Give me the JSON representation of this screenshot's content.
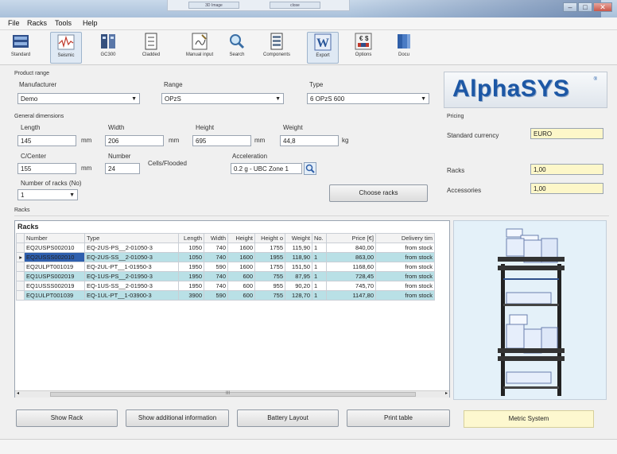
{
  "top_strip": {
    "btn1": "3D Image",
    "btn2": "close"
  },
  "menu": [
    "File",
    "Racks",
    "Tools",
    "Help"
  ],
  "toolbar": [
    {
      "label": "Standard",
      "icon": "rack-standard-icon"
    },
    {
      "label": "Seismic",
      "icon": "seismic-chart-icon"
    },
    {
      "label": "GC300",
      "icon": "gc300-icon"
    },
    {
      "label": "Cladded",
      "icon": "cladded-icon"
    },
    {
      "label": "Manual input",
      "icon": "manual-input-icon"
    },
    {
      "label": "Search",
      "icon": "search-icon"
    },
    {
      "label": "Components",
      "icon": "components-icon"
    },
    {
      "label": "Export",
      "icon": "word-export-icon"
    },
    {
      "label": "Options",
      "icon": "currency-options-icon"
    },
    {
      "label": "Docu",
      "icon": "documentation-icon"
    }
  ],
  "product_range": {
    "title": "Product range",
    "manufacturer_label": "Manufacturer",
    "manufacturer_value": "Demo",
    "range_label": "Range",
    "range_value": "OPzS",
    "type_label": "Type",
    "type_value": "6 OPzS  600"
  },
  "dimensions": {
    "title": "General dimensions",
    "length_label": "Length",
    "length_value": "145",
    "length_unit": "mm",
    "width_label": "Width",
    "width_value": "206",
    "width_unit": "mm",
    "height_label": "Height",
    "height_value": "695",
    "height_unit": "mm",
    "weight_label": "Weight",
    "weight_value": "44,8",
    "weight_unit": "kg",
    "ccenter_label": "C/Center",
    "ccenter_value": "155",
    "ccenter_unit": "mm",
    "number_label": "Number",
    "number_value": "24",
    "cells_label": "Cells/Flooded",
    "accel_label": "Acceleration",
    "accel_value": "0.2 g - UBC Zone 1",
    "racks_no_label": "Number of racks (No)",
    "racks_no_value": "1",
    "choose_racks": "Choose racks"
  },
  "logo": {
    "text": "AlphaSYS",
    "mark": "®"
  },
  "pricing": {
    "title": "Pricing",
    "currency_label": "Standard currency",
    "currency_value": "EURO",
    "racks_label": "Racks",
    "racks_value": "1,00",
    "accessories_label": "Accessories",
    "accessories_value": "1,00"
  },
  "racks_section_label": "Racks",
  "table": {
    "title": "Racks",
    "columns": [
      "Number",
      "Type",
      "Length",
      "Width",
      "Height",
      "Height o",
      "Weight",
      "No.",
      "Price [€]",
      "Delivery tim"
    ],
    "rows": [
      [
        "EQ2USPS002010",
        "EQ-2US-PS__2-01050-3",
        "1050",
        "740",
        "1600",
        "1755",
        "115,90",
        "1",
        "840,00",
        "from stock"
      ],
      [
        "EQ2USSS002010",
        "EQ-2US-SS__2-01050-3",
        "1050",
        "740",
        "1600",
        "1955",
        "118,90",
        "1",
        "863,00",
        "from stock"
      ],
      [
        "EQ2ULPT001019",
        "EQ-2UL-PT__1-01950-3",
        "1950",
        "590",
        "1600",
        "1755",
        "151,50",
        "1",
        "1168,60",
        "from stock"
      ],
      [
        "EQ1USPS002019",
        "EQ-1US-PS__2-01950-3",
        "1950",
        "740",
        "600",
        "755",
        "87,95",
        "1",
        "728,45",
        "from stock"
      ],
      [
        "EQ1USSS002019",
        "EQ-1US-SS__2-01950-3",
        "1950",
        "740",
        "600",
        "955",
        "90,20",
        "1",
        "745,70",
        "from stock"
      ],
      [
        "EQ1ULPT001039",
        "EQ-1UL-PT__1-03900-3",
        "3900",
        "590",
        "600",
        "755",
        "128,70",
        "1",
        "1147,80",
        "from stock"
      ]
    ],
    "selected_row": 1,
    "scroll_label": "III"
  },
  "buttons": {
    "show_rack": "Show Rack",
    "show_info": "Show additional information",
    "battery_layout": "Battery Layout",
    "print_table": "Print table"
  },
  "metric": "Metric System",
  "colors": {
    "accent_teal": "#b9e0e6",
    "selection": "#2e5fae",
    "logo_blue": "#1c57a5",
    "pricing_yellow": "#fdf7c9"
  }
}
